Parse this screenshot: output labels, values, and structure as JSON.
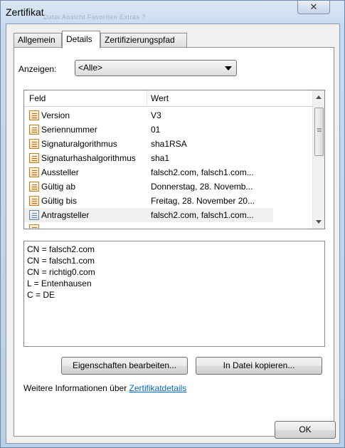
{
  "window": {
    "title": "Zertifikat",
    "close_glyph": "✕",
    "background_menu_ghost": "Datei   Ansicht   Favoriten   Extras   ?"
  },
  "tabs": [
    {
      "label": "Allgemein",
      "active": false
    },
    {
      "label": "Details",
      "active": true
    },
    {
      "label": "Zertifizierungspfad",
      "active": false
    }
  ],
  "show": {
    "label": "Anzeigen:",
    "selected": "<Alle>"
  },
  "list": {
    "columns": [
      "Feld",
      "Wert"
    ],
    "rows": [
      {
        "field": "Version",
        "value": "V3",
        "icon": "certificate-field-icon",
        "selected": false
      },
      {
        "field": "Seriennummer",
        "value": "01",
        "icon": "certificate-field-icon",
        "selected": false
      },
      {
        "field": "Signaturalgorithmus",
        "value": "sha1RSA",
        "icon": "certificate-field-icon",
        "selected": false
      },
      {
        "field": "Signaturhashalgorithmus",
        "value": "sha1",
        "icon": "certificate-field-icon",
        "selected": false
      },
      {
        "field": "Aussteller",
        "value": "falsch2.com, falsch1.com...",
        "icon": "certificate-field-icon",
        "selected": false
      },
      {
        "field": "Gültig ab",
        "value": "Donnerstag, 28. Novemb...",
        "icon": "certificate-field-icon",
        "selected": false
      },
      {
        "field": "Gültig bis",
        "value": "Freitag, 28. November 20...",
        "icon": "certificate-field-icon",
        "selected": false
      },
      {
        "field": "Antragsteller",
        "value": "falsch2.com, falsch1.com...",
        "icon": "certificate-field-icon",
        "selected": true
      }
    ]
  },
  "details": [
    "CN = falsch2.com",
    "CN = falsch1.com",
    "CN = richtig0.com",
    "L = Entenhausen",
    "C = DE"
  ],
  "buttons": {
    "edit_properties": "Eigenschaften bearbeiten...",
    "copy_to_file": "In Datei kopieren...",
    "ok": "OK"
  },
  "info": {
    "text": "Weitere Informationen über ",
    "link": "Zertifikatdetails"
  },
  "colors": {
    "link": "#0066cc",
    "selected_row": "#f0f0f0",
    "window_frame": "#c7d9ee"
  }
}
